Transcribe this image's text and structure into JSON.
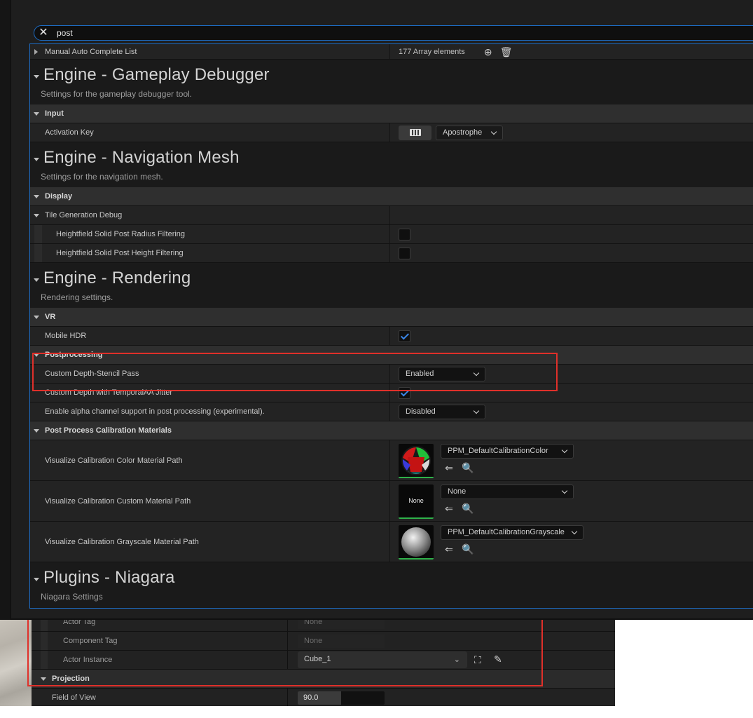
{
  "search": {
    "query": "post",
    "clear_icon": "close-icon"
  },
  "manual_list": {
    "label": "Manual Auto Complete List",
    "count": "177 Array elements"
  },
  "sections": {
    "gameplay_debugger": {
      "title": "Engine - Gameplay Debugger",
      "desc": "Settings for the gameplay debugger tool.",
      "input_cat": "Input",
      "activation_key_label": "Activation Key",
      "activation_key_value": "Apostrophe"
    },
    "navigation_mesh": {
      "title": "Engine - Navigation Mesh",
      "desc": "Settings for the navigation mesh.",
      "display_cat": "Display",
      "tile_debug_label": "Tile Generation Debug",
      "radius_filter_label": "Heightfield Solid Post Radius Filtering",
      "radius_filter_checked": false,
      "height_filter_label": "Heightfield Solid Post Height Filtering",
      "height_filter_checked": false
    },
    "rendering": {
      "title": "Engine - Rendering",
      "desc": "Rendering settings.",
      "vr_cat": "VR",
      "mobile_hdr_label": "Mobile HDR",
      "mobile_hdr_checked": true,
      "postprocessing_cat": "Postprocessing",
      "custom_depth_label": "Custom Depth-Stencil Pass",
      "custom_depth_value": "Enabled",
      "custom_depth_taa_label": "Custom Depth with TemporalAA Jitter",
      "custom_depth_taa_checked": true,
      "alpha_label": "Enable alpha channel support in post processing (experimental).",
      "alpha_value": "Disabled",
      "calib_cat": "Post Process Calibration Materials",
      "calib_color_label": "Visualize Calibration Color Material Path",
      "calib_color_value": "PPM_DefaultCalibrationColor",
      "calib_custom_label": "Visualize Calibration Custom Material Path",
      "calib_custom_value": "None",
      "calib_custom_thumb": "None",
      "calib_gray_label": "Visualize Calibration Grayscale Material Path",
      "calib_gray_value": "PPM_DefaultCalibrationGrayscale"
    },
    "niagara": {
      "title": "Plugins - Niagara",
      "desc": "Niagara Settings"
    }
  },
  "back_panel": {
    "actor_tag_label": "Actor Tag",
    "actor_tag_value": "None",
    "component_tag_label": "Component Tag",
    "component_tag_value": "None",
    "actor_instance_label": "Actor Instance",
    "actor_instance_value": "Cube_1",
    "projection_cat": "Projection",
    "fov_label": "Field of View",
    "fov_value": "90.0",
    "fov_fill_fraction": 0.5
  },
  "colors": {
    "highlight": "#e0302a",
    "focus": "#1d6cc4",
    "checkbox": "#3a86e8",
    "asset_ok": "#2fb24a"
  }
}
